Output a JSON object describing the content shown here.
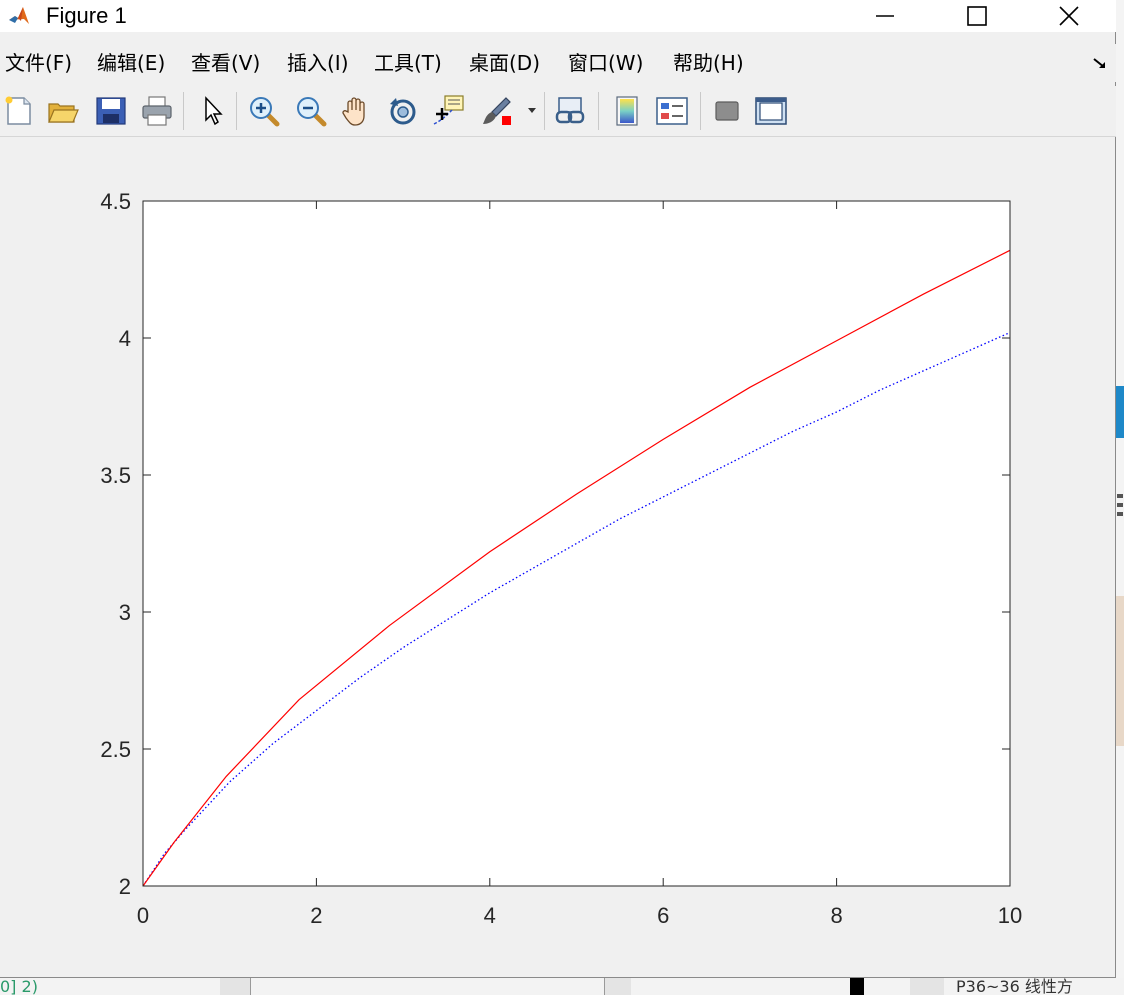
{
  "window": {
    "title": "Figure 1"
  },
  "menu": {
    "items": [
      {
        "label": "文件(F)"
      },
      {
        "label": "编辑(E)"
      },
      {
        "label": "查看(V)"
      },
      {
        "label": "插入(I)"
      },
      {
        "label": "工具(T)"
      },
      {
        "label": "桌面(D)"
      },
      {
        "label": "窗口(W)"
      },
      {
        "label": "帮助(H)"
      }
    ]
  },
  "toolbar": {
    "tools": [
      "new-figure-icon",
      "open-file-icon",
      "save-icon",
      "print-icon",
      "select-arrow-icon",
      "zoom-in-icon",
      "zoom-out-icon",
      "pan-hand-icon",
      "rotate-3d-icon",
      "data-cursor-icon",
      "brush-icon",
      "link-plot-icon",
      "colorbar-icon",
      "legend-icon",
      "hide-plot-tools-icon",
      "show-plot-tools-icon"
    ]
  },
  "colors": {
    "series_red": "#ff0000",
    "series_blue": "#0000ff",
    "window_bg": "#f0f0f0"
  },
  "background": {
    "bottom_left_text": "0] 2)",
    "bottom_right_text": "P36~36 线性方"
  },
  "chart_data": {
    "type": "line",
    "title": "",
    "xlabel": "",
    "ylabel": "",
    "xlim": [
      0,
      10
    ],
    "ylim": [
      2,
      4.5
    ],
    "xticks": [
      0,
      2,
      4,
      6,
      8,
      10
    ],
    "yticks": [
      2,
      2.5,
      3,
      3.5,
      4,
      4.5
    ],
    "xtick_labels": [
      "0",
      "2",
      "4",
      "6",
      "8",
      "10"
    ],
    "ytick_labels": [
      "2",
      "2.5",
      "3",
      "3.5",
      "4",
      "4.5"
    ],
    "grid": false,
    "series": [
      {
        "color": "#0000ff",
        "style": "dotted",
        "x": [
          0,
          0.25,
          0.5,
          1,
          1.5,
          2,
          2.5,
          3,
          3.5,
          4,
          4.5,
          5,
          5.5,
          6,
          6.5,
          7,
          7.5,
          8,
          8.5,
          9,
          9.5,
          10
        ],
        "y": [
          2.0,
          2.12,
          2.21,
          2.38,
          2.52,
          2.64,
          2.76,
          2.87,
          2.97,
          3.07,
          3.16,
          3.25,
          3.34,
          3.42,
          3.5,
          3.58,
          3.66,
          3.73,
          3.81,
          3.88,
          3.95,
          4.02
        ]
      },
      {
        "color": "#ff0000",
        "style": "solid",
        "x": [
          0,
          0.36,
          0.96,
          1.8,
          2.84,
          4.0,
          5.0,
          6.0,
          7.0,
          8.0,
          9.0,
          10
        ],
        "y": [
          2.0,
          2.16,
          2.4,
          2.68,
          2.95,
          3.22,
          3.43,
          3.63,
          3.82,
          3.99,
          4.16,
          4.32
        ]
      }
    ]
  }
}
